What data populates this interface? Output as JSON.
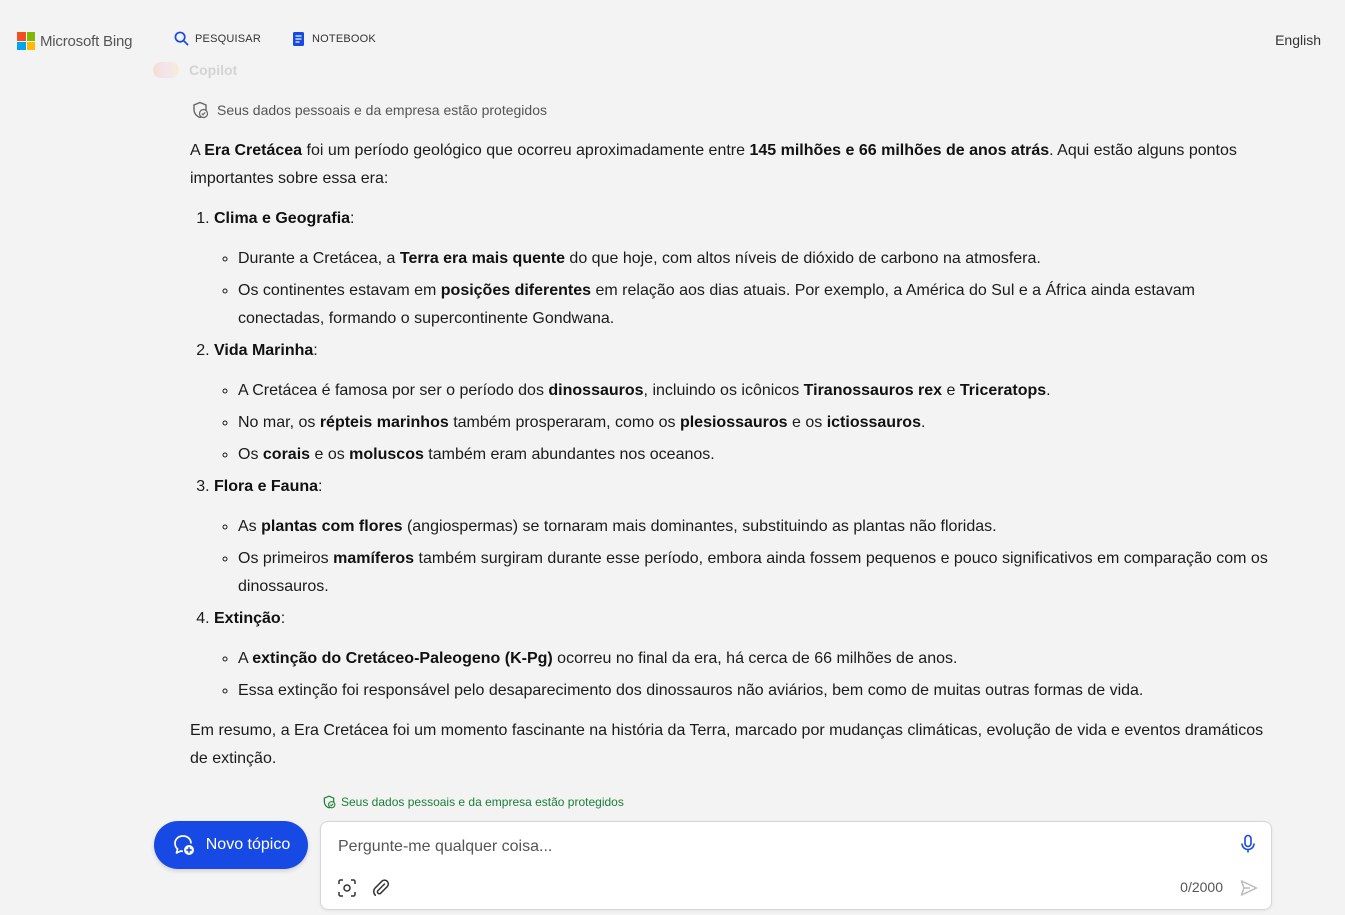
{
  "header": {
    "brand": "Microsoft Bing",
    "brand_colors": [
      "#f25022",
      "#7fba00",
      "#00a4ef",
      "#ffb900"
    ],
    "nav": [
      {
        "label": "PESQUISAR",
        "icon": "search-icon"
      },
      {
        "label": "NOTEBOOK",
        "icon": "notebook-icon"
      }
    ],
    "language": "English"
  },
  "chat": {
    "faded_label": "Copilot",
    "protection_notice": "Seus dados pessoais e da empresa estão protegidos",
    "intro": {
      "t1": "A ",
      "b1": "Era Cretácea",
      "t2": " foi um período geológico que ocorreu aproximadamente entre ",
      "b2": "145 milhões e 66 milhões de anos atrás",
      "t3": ". Aqui estão alguns pontos importantes sobre essa era:"
    },
    "sections": [
      {
        "title": "Clima e Geografia",
        "bullets": [
          {
            "t1": "Durante a Cretácea, a ",
            "b1": "Terra era mais quente",
            "t2": " do que hoje, com altos níveis de dióxido de carbono na atmosfera."
          },
          {
            "t1": "Os continentes estavam em ",
            "b1": "posições diferentes",
            "t2": " em relação aos dias atuais. Por exemplo, a América do Sul e a África ainda estavam conectadas, formando o supercontinente Gondwana."
          }
        ]
      },
      {
        "title": "Vida Marinha",
        "bullets": [
          {
            "t1": "A Cretácea é famosa por ser o período dos ",
            "b1": "dinossauros",
            "t2": ", incluindo os icônicos ",
            "b2": "Tiranossauros rex",
            "t3": " e ",
            "b3": "Triceratops",
            "t4": "."
          },
          {
            "t1": "No mar, os ",
            "b1": "répteis marinhos",
            "t2": " também prosperaram, como os ",
            "b2": "plesiossauros",
            "t3": " e os ",
            "b3": "ictiossauros",
            "t4": "."
          },
          {
            "t1": "Os ",
            "b1": "corais",
            "t2": " e os ",
            "b2": "moluscos",
            "t3": " também eram abundantes nos oceanos."
          }
        ]
      },
      {
        "title": "Flora e Fauna",
        "bullets": [
          {
            "t1": "As ",
            "b1": "plantas com flores",
            "t2": " (angiospermas) se tornaram mais dominantes, substituindo as plantas não floridas."
          },
          {
            "t1": "Os primeiros ",
            "b1": "mamíferos",
            "t2": " também surgiram durante esse período, embora ainda fossem pequenos e pouco significativos em comparação com os dinossauros."
          }
        ]
      },
      {
        "title": "Extinção",
        "bullets": [
          {
            "t1": "A ",
            "b1": "extinção do Cretáceo-Paleogeno (K-Pg)",
            "t2": " ocorreu no final da era, há cerca de 66 milhões de anos."
          },
          {
            "t1": "Essa extinção foi responsável pelo desaparecimento dos dinossauros não aviários, bem como de muitas outras formas de vida."
          }
        ]
      }
    ],
    "summary": "Em resumo, a Era Cretácea foi um momento fascinante na história da Terra, marcado por mudanças climáticas, evolução de vida e eventos dramáticos de extinção."
  },
  "composer": {
    "protection_notice": "Seus dados pessoais e da empresa estão protegidos",
    "new_topic_label": "Novo tópico",
    "placeholder": "Pergunte-me qualquer coisa...",
    "counter": "0/2000",
    "accent_color": "#174ae4"
  }
}
